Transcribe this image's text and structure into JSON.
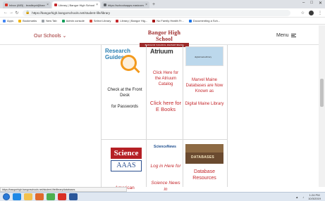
{
  "browser": {
    "tabs": [
      {
        "label": "Inbox (683) - bradleyct@bangor...",
        "favicon_color": "#d93025",
        "active": false
      },
      {
        "label": "Library | Bangor High School",
        "favicon_color": "#c4272b",
        "active": true
      },
      {
        "label": "https://schoolsapps.eastcomm.edu",
        "favicon_color": "#5f6368",
        "active": false
      }
    ],
    "new_tab": "+",
    "window_controls": [
      "–",
      "□",
      "✕"
    ],
    "url": "https://bangorhigh.bangorschools.net/student-life/library",
    "bookmarks": [
      {
        "label": "Apps",
        "color": "#4285f4"
      },
      {
        "label": "Bookmarks",
        "color": "#f4b400"
      },
      {
        "label": "New Tab",
        "color": "#9aa0a6"
      },
      {
        "label": "Admin console",
        "color": "#0f9d58"
      },
      {
        "label": "Select Library",
        "color": "#db4437"
      },
      {
        "label": "Library | Bangor Hig...",
        "color": "#c4272b"
      },
      {
        "label": "No Family Health Fr...",
        "color": "#a50e0e"
      },
      {
        "label": "Documenting a Sch...",
        "color": "#1a73e8"
      }
    ]
  },
  "site": {
    "our_schools": "Our Schools",
    "logo_title": "Bangor High School",
    "logo_subtitle": "BANGOR SCHOOL DEPARTMENT",
    "menu_label": "Menu"
  },
  "grid": {
    "col1": {
      "logo_text": "Research Guides",
      "check_text": "Check at the Front Desk",
      "passwords_text": "for Passwords",
      "science_top": "Science",
      "science_bottom": "AAAS",
      "american_text": "American"
    },
    "col2": {
      "atrium_logo": "Atriuum",
      "catalog_link": "Click Here for the Atriuum Catalog",
      "ebooks_link": "Click here for E Books",
      "sciencenews_logo": "ScienceNews",
      "login_link": "Log in Here for",
      "sciencenews_link": "Science News in"
    },
    "col3": {
      "maine_logo": "digitalmainelibrary",
      "marvel_text": "Marvel Maine Databases are Now Known as",
      "digital_link": "Digital Maine Library",
      "databases_logo": "DATABASES",
      "db_resources": "Database Resources"
    }
  },
  "status_bar": "https://bangorhigh.bangorschools.net/student-life/library/databases",
  "taskbar": {
    "icons": [
      {
        "name": "ie",
        "color": "#1e88e5"
      },
      {
        "name": "explorer",
        "color": "#f2c14e"
      },
      {
        "name": "media",
        "color": "#e06a2c"
      },
      {
        "name": "chrome",
        "color": "#4caf50"
      },
      {
        "name": "chrome2",
        "color": "#d93025"
      },
      {
        "name": "word",
        "color": "#2b579a"
      }
    ],
    "time": "1:24 PM",
    "date": "10/3/2019"
  }
}
